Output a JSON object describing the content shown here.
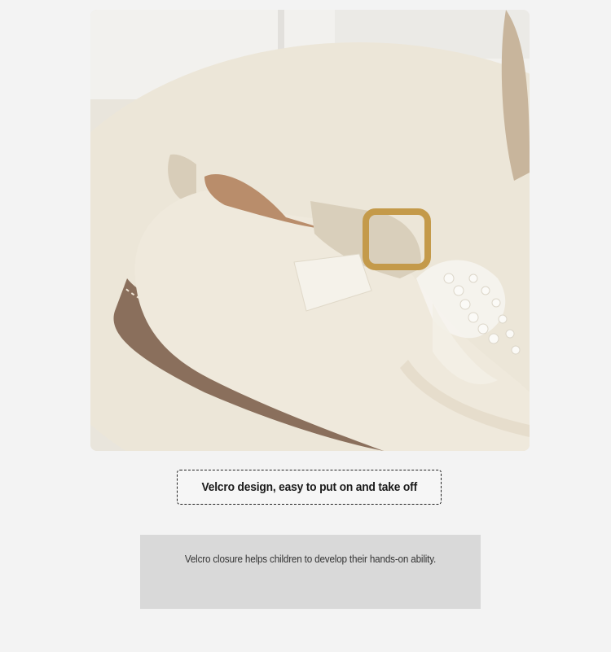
{
  "product_photo": {
    "alt": "Cream leather children's shoe with gold buckle, velcro strap and pearl lace bow"
  },
  "caption": {
    "title": "Velcro design, easy to put on and take off"
  },
  "description": {
    "text": "Velcro closure helps children to develop their hands-on ability."
  },
  "colors": {
    "page_background": "#f3f3f3",
    "caption_border": "#222222",
    "description_background": "#d9d9d9",
    "shoe_leather": "#efe9dc",
    "sole": "#8a6f5c",
    "buckle_gold": "#c49a4a"
  }
}
